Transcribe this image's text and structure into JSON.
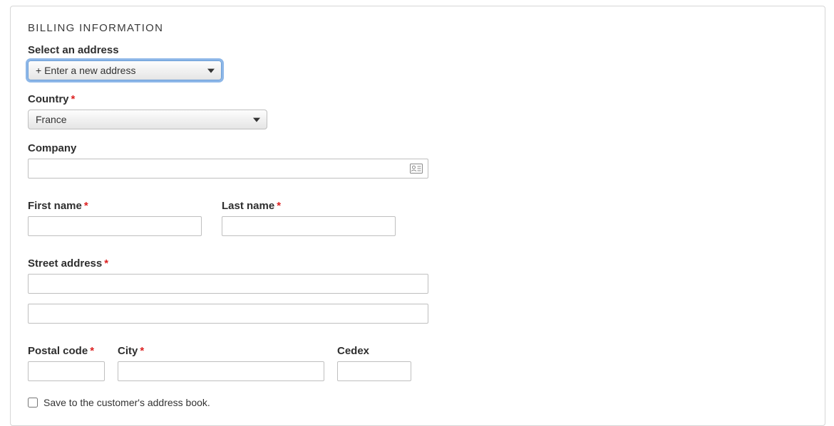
{
  "panel": {
    "title": "BILLING INFORMATION"
  },
  "fields": {
    "selectAddress": {
      "label": "Select an address",
      "value": "+ Enter a new address"
    },
    "country": {
      "label": "Country",
      "value": "France",
      "required_mark": "*"
    },
    "company": {
      "label": "Company",
      "value": ""
    },
    "firstName": {
      "label": "First name",
      "value": "",
      "required_mark": "*"
    },
    "lastName": {
      "label": "Last name",
      "value": "",
      "required_mark": "*"
    },
    "street": {
      "label": "Street address",
      "value1": "",
      "value2": "",
      "required_mark": "*"
    },
    "postal": {
      "label": "Postal code",
      "value": "",
      "required_mark": "*"
    },
    "city": {
      "label": "City",
      "value": "",
      "required_mark": "*"
    },
    "cedex": {
      "label": "Cedex",
      "value": ""
    },
    "saveAddress": {
      "label": "Save to the customer's address book."
    }
  }
}
